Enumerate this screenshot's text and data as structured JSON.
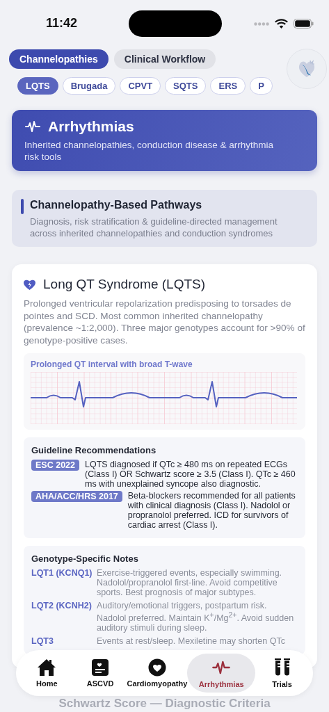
{
  "status_bar": {
    "time": "11:42"
  },
  "segments": [
    {
      "label": "Channelopathies",
      "selected": true
    },
    {
      "label": "Clinical Workflow",
      "selected": false
    }
  ],
  "chips": [
    {
      "label": "LQTS",
      "selected": true
    },
    {
      "label": "Brugada",
      "selected": false
    },
    {
      "label": "CPVT",
      "selected": false
    },
    {
      "label": "SQTS",
      "selected": false
    },
    {
      "label": "ERS",
      "selected": false
    },
    {
      "label": "P",
      "selected": false
    }
  ],
  "hero": {
    "title": "Arrhythmias",
    "subtitle": "Inherited channelopathies, conduction disease & arrhythmia risk tools"
  },
  "pathway": {
    "title": "Channelopathy-Based Pathways",
    "description": "Diagnosis, risk stratification & guideline-directed management across inherited channelopathies and conduction syndromes"
  },
  "card": {
    "title": "Long QT Syndrome (LQTS)",
    "description": "Prolonged ventricular repolarization predisposing to torsades de pointes and SCD. Most common inherited channelopathy (prevalence ~1:2,000). Three major genotypes account for >90% of genotype-positive cases.",
    "ecg": {
      "caption": "Prolonged QT interval with broad T-wave"
    },
    "guidelines": {
      "title": "Guideline Recommendations",
      "items": [
        {
          "badge": "ESC 2022",
          "text": "LQTS diagnosed if QTc ≥ 480 ms on repeated ECGs (Class I) OR Schwartz score ≥ 3.5 (Class I). QTc ≥ 460 ms with unexplained syncope also diagnostic."
        },
        {
          "badge": "AHA/ACC/HRS 2017",
          "text": "Beta-blockers recommended for all patients with clinical diagnosis (Class I). Nadolol or propranolol preferred. ICD for survivors of cardiac arrest (Class I)."
        }
      ]
    },
    "genotypes": {
      "title": "Genotype-Specific Notes",
      "items": [
        {
          "gene": "LQT1 (KCNQ1)",
          "text": "Exercise-triggered events, especially swimming. Nadolol/propranolol first-line. Avoid competitive sports. Best prognosis of major subtypes."
        },
        {
          "gene": "LQT2 (KCNH2)",
          "text": "Auditory/emotional triggers, postpartum risk. Nadolol preferred. Maintain K$^{+}$/Mg$^{2+}$. Avoid sudden auditory stimuli during sleep."
        },
        {
          "gene": "LQT3",
          "text": "Events at rest/sleep. Mexiletine may shorten QTc"
        }
      ]
    }
  },
  "next_section": {
    "title": "Schwartz Score — Diagnostic Criteria"
  },
  "tab_bar": [
    {
      "label": "Home",
      "selected": false
    },
    {
      "label": "ASCVD",
      "selected": false
    },
    {
      "label": "Cardiomyopathy",
      "selected": false
    },
    {
      "label": "Arrhythmias",
      "selected": true
    },
    {
      "label": "Trials",
      "selected": false
    }
  ]
}
